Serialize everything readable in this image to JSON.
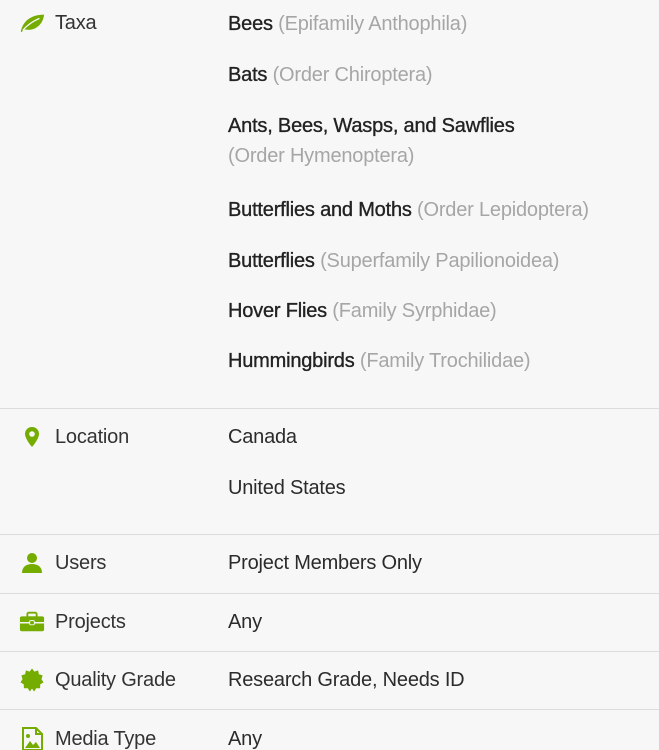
{
  "colors": {
    "accent": "#74ac00",
    "text": "#2b2b2b",
    "muted": "#a6a6a6",
    "divider": "#dcdcdc",
    "background": "#f7f7f7"
  },
  "taxa": {
    "label": "Taxa",
    "icon": "leaf-icon",
    "items": [
      {
        "name": "Bees",
        "rank": "(Epifamily Anthophila)"
      },
      {
        "name": "Bats",
        "rank": "(Order Chiroptera)"
      },
      {
        "name": "Ants, Bees, Wasps, and Sawflies",
        "rank": "(Order Hymenoptera)"
      },
      {
        "name": "Butterflies and Moths",
        "rank": "(Order Lepidoptera)"
      },
      {
        "name": "Butterflies",
        "rank": "(Superfamily Papilionoidea)"
      },
      {
        "name": "Hover Flies",
        "rank": "(Family Syrphidae)"
      },
      {
        "name": "Hummingbirds",
        "rank": "(Family Trochilidae)"
      }
    ]
  },
  "location": {
    "label": "Location",
    "icon": "map-marker-icon",
    "items": [
      "Canada",
      "United States"
    ]
  },
  "users": {
    "label": "Users",
    "icon": "user-icon",
    "value": "Project Members Only"
  },
  "projects": {
    "label": "Projects",
    "icon": "briefcase-icon",
    "value": "Any"
  },
  "quality_grade": {
    "label": "Quality Grade",
    "icon": "certificate-icon",
    "value": "Research Grade, Needs ID"
  },
  "media_type": {
    "label": "Media Type",
    "icon": "image-file-icon",
    "value": "Any"
  }
}
